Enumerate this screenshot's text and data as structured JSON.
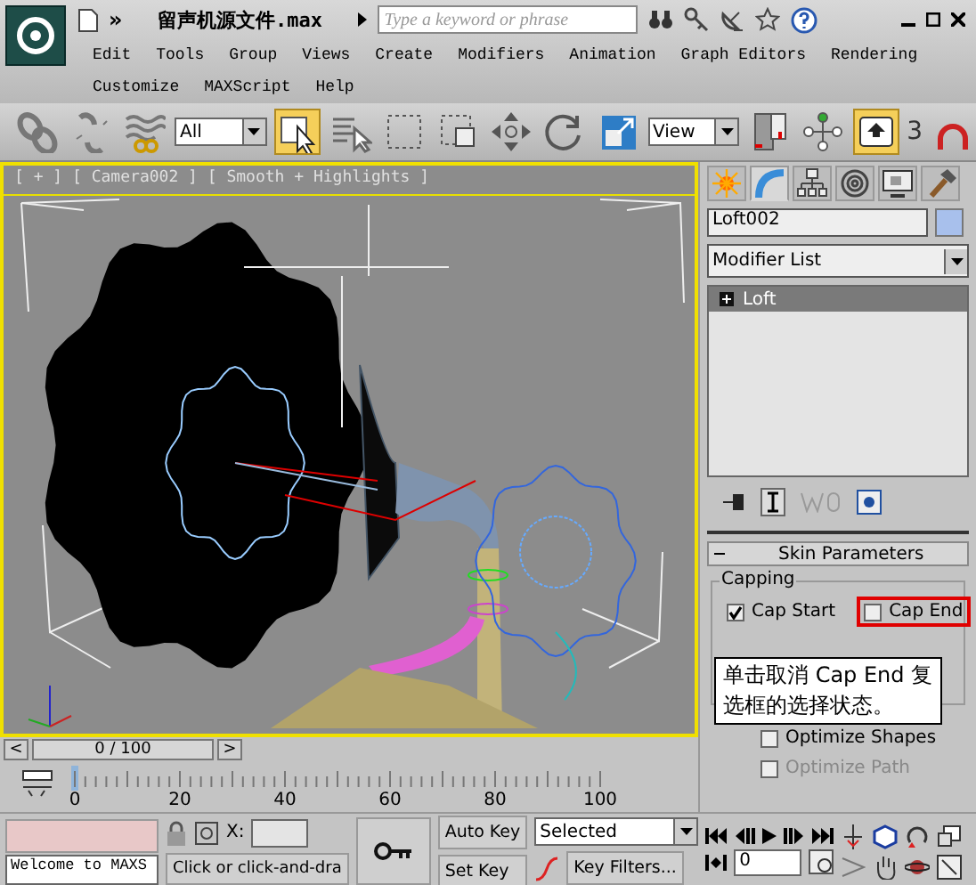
{
  "title_bar": {
    "overflow": "»",
    "file_name": "留声机源文件.max",
    "search_placeholder": "Type a keyword or phrase"
  },
  "menu": {
    "items": [
      "Edit",
      "Tools",
      "Group",
      "Views",
      "Create",
      "Modifiers",
      "Animation",
      "Graph Editors",
      "Rendering",
      "Customize",
      "MAXScript",
      "Help"
    ]
  },
  "toolbar": {
    "items": [
      {
        "kind": "button",
        "active": false
      },
      {
        "kind": "button",
        "active": false
      },
      {
        "kind": "button",
        "active": false
      },
      {
        "kind": "dropdown",
        "value": "All"
      },
      {
        "kind": "button",
        "active": true
      },
      {
        "kind": "button",
        "active": false
      },
      {
        "kind": "button",
        "active": false
      },
      {
        "kind": "button",
        "active": false
      },
      {
        "kind": "button",
        "active": false
      },
      {
        "kind": "button",
        "active": false
      },
      {
        "kind": "button",
        "active": false
      },
      {
        "kind": "dropdown",
        "value": "View"
      },
      {
        "kind": "button",
        "active": false
      },
      {
        "kind": "button",
        "active": false
      },
      {
        "kind": "button",
        "active": true
      },
      {
        "kind": "snap",
        "label": "3"
      },
      {
        "kind": "button",
        "active": false
      }
    ]
  },
  "viewport": {
    "label": "[ + ] [ Camera002 ] [ Smooth + Highlights ]",
    "active": true
  },
  "command_panel": {
    "tabs": [
      {
        "selected": false
      },
      {
        "selected": true
      },
      {
        "selected": false
      },
      {
        "selected": false
      },
      {
        "selected": false
      },
      {
        "selected": false
      }
    ],
    "object_name": "Loft002",
    "modifier_list": "Modifier List",
    "stack": [
      {
        "label": "Loft",
        "expanded": false,
        "selected": true
      }
    ],
    "rollout": {
      "title": "Skin Parameters",
      "expanded": true
    },
    "capping": {
      "label": "Capping",
      "options": [
        {
          "label": "Cap Start",
          "checked": true,
          "highlighted": false
        },
        {
          "label": "Cap End",
          "checked": false,
          "highlighted": true
        }
      ]
    },
    "options": [
      {
        "label": "Optimize Shapes",
        "checked": false,
        "disabled": false
      },
      {
        "label": "Optimize Path",
        "checked": false,
        "disabled": true
      }
    ],
    "callout": "单击取消 Cap End 复选框的选择状态。"
  },
  "timeline": {
    "position": "0 / 100",
    "prev": "<",
    "next": ">",
    "ticks": [
      "0",
      "20",
      "40",
      "60",
      "80",
      "100"
    ]
  },
  "status_bar": {
    "message": "Welcome to MAXS",
    "prompt": "Click or click-and-dra",
    "x_label": "X:",
    "auto_key": "Auto Key",
    "set_key": "Set Key",
    "key_mode": "Selected",
    "key_filters": "Key Filters...",
    "frame": "0"
  }
}
